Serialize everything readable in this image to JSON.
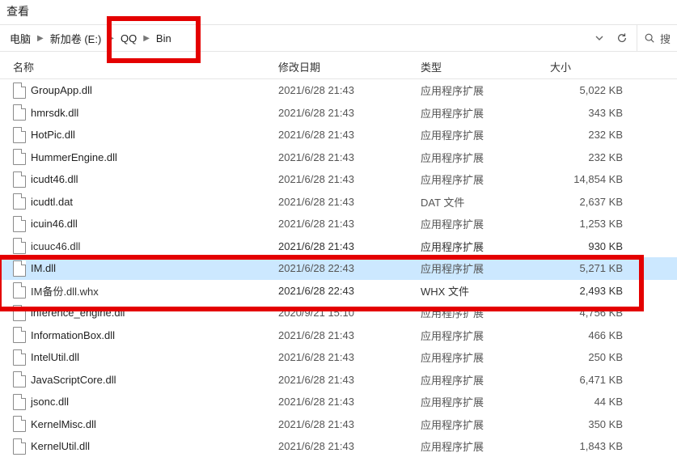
{
  "window": {
    "menu_label": "查看"
  },
  "breadcrumb": {
    "segments": [
      "电脑",
      "新加卷 (E:)",
      "QQ",
      "Bin"
    ]
  },
  "search": {
    "label": "搜"
  },
  "columns": {
    "name": "名称",
    "date": "修改日期",
    "type": "类型",
    "size": "大小"
  },
  "type_labels": {
    "ext": "应用程序扩展",
    "dat": "DAT 文件",
    "whx": "WHX 文件"
  },
  "files": [
    {
      "name": "GroupApp.dll",
      "date": "2021/6/28 21:43",
      "type": "ext",
      "size": "5,022 KB"
    },
    {
      "name": "hmrsdk.dll",
      "date": "2021/6/28 21:43",
      "type": "ext",
      "size": "343 KB"
    },
    {
      "name": "HotPic.dll",
      "date": "2021/6/28 21:43",
      "type": "ext",
      "size": "232 KB"
    },
    {
      "name": "HummerEngine.dll",
      "date": "2021/6/28 21:43",
      "type": "ext",
      "size": "232 KB"
    },
    {
      "name": "icudt46.dll",
      "date": "2021/6/28 21:43",
      "type": "ext",
      "size": "14,854 KB"
    },
    {
      "name": "icudtl.dat",
      "date": "2021/6/28 21:43",
      "type": "dat",
      "size": "2,637 KB"
    },
    {
      "name": "icuin46.dll",
      "date": "2021/6/28 21:43",
      "type": "ext",
      "size": "1,253 KB"
    },
    {
      "name": "icuuc46.dll",
      "date": "2021/6/28 21:43",
      "type": "ext",
      "size": "930 KB",
      "obscured": true
    },
    {
      "name": "IM.dll",
      "date": "2021/6/28 22:43",
      "type": "ext",
      "size": "5,271 KB",
      "selected": true
    },
    {
      "name": "IM备份.dll.whx",
      "date": "2021/6/28 22:43",
      "type": "whx",
      "size": "2,493 KB",
      "obscured": true
    },
    {
      "name": "inference_engine.dll",
      "date": "2020/9/21 15:10",
      "type": "ext",
      "size": "4,756 KB"
    },
    {
      "name": "InformationBox.dll",
      "date": "2021/6/28 21:43",
      "type": "ext",
      "size": "466 KB"
    },
    {
      "name": "IntelUtil.dll",
      "date": "2021/6/28 21:43",
      "type": "ext",
      "size": "250 KB"
    },
    {
      "name": "JavaScriptCore.dll",
      "date": "2021/6/28 21:43",
      "type": "ext",
      "size": "6,471 KB"
    },
    {
      "name": "jsonc.dll",
      "date": "2021/6/28 21:43",
      "type": "ext",
      "size": "44 KB"
    },
    {
      "name": "KernelMisc.dll",
      "date": "2021/6/28 21:43",
      "type": "ext",
      "size": "350 KB"
    },
    {
      "name": "KernelUtil.dll",
      "date": "2021/6/28 21:43",
      "type": "ext",
      "size": "1,843 KB"
    }
  ]
}
